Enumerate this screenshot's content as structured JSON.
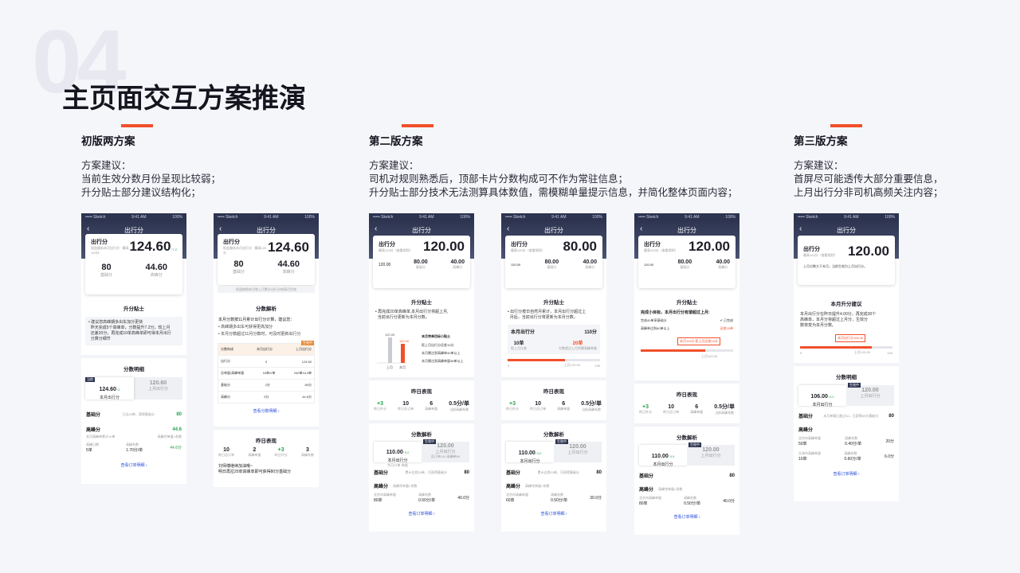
{
  "page": {
    "number": "04",
    "title": "主页面交互方案推演"
  },
  "sections": [
    {
      "heading": "初版两方案",
      "desc": "方案建议：\n当前生效分数月份呈现比较弱；\n升分贴士部分建议结构化；"
    },
    {
      "heading": "第二版方案",
      "desc": "方案建议：\n司机对规则熟悉后，顶部卡片分数构成可不作为常驻信息；\n升分贴士部分技术无法测算具体数值，需模糊单量提示信息，并简化整体页面内容；"
    },
    {
      "heading": "第三版方案",
      "desc": "方案建议：\n首屏尽可能透传大部分重要信息，\n上月出行分非司机高频关注内容；"
    }
  ],
  "phone": {
    "carrier": "••••• Sketch",
    "time": "9:41 AM",
    "battery": "100%",
    "back": "‹",
    "nav_title": "出行分",
    "score_label": "出行分",
    "link_detail": "查看订单明细 ›",
    "link_analysis": "查看分数明细 ›"
  },
  "p1": {
    "sub": "权益服务本月出行分 · 最高120分",
    "score": "124.60",
    "delta": "↑7.2",
    "base": "80",
    "base_l": "基础分",
    "peak": "44.60",
    "peak_l": "高峰分",
    "tips_t": "升分贴士",
    "tips": "• 建议您高峰期多出车加分更快\n  昨天完成5个高峰单，分数提升7.2分，较上月\n  还差20分，再完成10单高峰单即可得本月出行\n  分算分细节",
    "detail_t": "分数明细",
    "tag": "当前",
    "cur": "124.60",
    "cur_d": "+2",
    "cur_l": "本月出行分",
    "last": "120.60",
    "last_l": "上月出行分",
    "r1_l": "基础分",
    "r1_s": "已达20单，获得基础分",
    "r1_v": "80",
    "r2_l": "高峰分",
    "r2_v": "44.6",
    "r2_s": "本月高峰单累计10单",
    "r2_s2": "高峰完单量×系数",
    "r3_a": "高峰日期",
    "r3_a2": "5单",
    "r3_b": "高峰系数",
    "r3_b2": "1.70分/单",
    "r3_v": "44.6分"
  },
  "p2": {
    "sub": "权益服务本月出行分 · 最高120分",
    "score": "124.60",
    "base": "80",
    "base_l": "基础分",
    "peak": "44.60",
    "peak_l": "高峰分",
    "note": "权益按照本月和上月累计出行分较高月生效",
    "an_t": "分数解析",
    "an_1": "本月分数按11月累计出行分计算，建议您：",
    "an_2": "• 高峰期多出车可获得更高加分",
    "an_3": "• 本月分数超过11月分数时，可及时更新出行分",
    "th": [
      "分数构成",
      "本月出行分",
      "上月出行分"
    ],
    "tag": "生效中",
    "rows": [
      [
        "出行分",
        "3",
        "124.60"
      ],
      [
        "总单量/高峰单量",
        "16单/2单",
        "240单/114单"
      ],
      [
        "基础分",
        "2分",
        "80分"
      ],
      [
        "高峰分",
        "2分",
        "44.6分"
      ]
    ],
    "y_t": "昨日表现",
    "y": [
      [
        "10",
        "昨日总订单"
      ],
      [
        "2",
        "高峰单量"
      ],
      [
        "+3",
        "昨日升分"
      ],
      [
        "3",
        "高峰系数"
      ]
    ],
    "msg": "刘师傅继续加油哦~\n明日再拉20单高峰单即可获得80分基础分"
  },
  "v2a": {
    "sub": "最高120分（查看规则）",
    "score": "120.00",
    "last": "120.00",
    "base": "80.00",
    "base_l": "基础分",
    "peak": "40.00",
    "peak_l": "高峰分",
    "tips_t": "升分贴士",
    "tips": "• 再完成20单高峰单,本月出行分将超上月,\n  当前出行分更新为本月分数。",
    "leg": "本月完单目标小贴士",
    "l1": "距上月出行分还差10分",
    "l2": "本月需达到高峰单40单以上",
    "l3": "本月需达到高峰单量38单以上",
    "bv1": "120.00",
    "bv2": "110.00",
    "bx1": "上月",
    "bx2": "本月",
    "y_t": "昨日表现",
    "y": [
      [
        "+3",
        "昨日升分"
      ],
      [
        "10",
        "昨日总订单"
      ],
      [
        "6",
        "高峰单量"
      ],
      [
        "0.5分/单",
        "当前高峰系数"
      ]
    ],
    "an_t": "分数解析",
    "cur": "110.00",
    "cur_d": "↑3.0",
    "cur_l": "本月出行分",
    "cur_s": "作日21单·单量",
    "tag": "生效中",
    "last_l": "上月出行分",
    "last_s": "总订单140·高峰单80",
    "r1": "基础分",
    "r1_s": "累计达到20单，可获得基础分",
    "r1_v": "80",
    "r2": "高峰分",
    "r2_s": "高峰完单量×系数",
    "r3_a": "北京市高峰单量",
    "r3_a2": "80单",
    "r3_b": "高峰系数",
    "r3_b2": "0.50分/单",
    "r3_v": "40.0分"
  },
  "v2b": {
    "sub": "最高120分（查看规则）",
    "score": "80.00",
    "last": "120.00",
    "base": "80.00",
    "base_l": "基础分",
    "peak": "40.00",
    "peak_l": "高峰分",
    "tips_t": "升分贴士",
    "tips": "• 出行分按日自然月累计，本月出行分超过上\n  月后，当前出行分将更新为本月分数。",
    "box_l": "本月出行分",
    "box_v": "110分",
    "s1": "10单",
    "s1_l": "距上月分差",
    "s2": "20单",
    "s2_l": "分数超过上月所需高峰单量",
    "ax0": "0",
    "ax1": "上月120.00",
    "ax2": "130",
    "y_t": "昨日表现",
    "y": [
      [
        "+3",
        "昨日升分"
      ],
      [
        "10",
        "昨日总订单"
      ],
      [
        "6",
        "高峰单量"
      ],
      [
        "0.5分/单",
        "当前高峰系数"
      ]
    ],
    "an_t": "分数解析",
    "cur": "110.00",
    "cur_d": "↑3.0",
    "cur_l": "本月出行分",
    "tag": "生效中",
    "last_l": "上月出行分",
    "r1": "基础分",
    "r1_s": "累计达到20单，可获得基础分",
    "r1_v": "80",
    "r2": "高峰分",
    "r2_s": "高峰完单量×系数",
    "r3_a": "北京市高峰单量",
    "r3_a2": "60单",
    "r3_b": "高峰系数",
    "r3_b2": "0.50分/单",
    "r3_v": "30.0分"
  },
  "v2c": {
    "sub": "最高120分（查看规则）",
    "score": "120.00",
    "last": "120.00",
    "base": "80.00",
    "base_l": "基础分",
    "peak": "40.00",
    "peak_l": "高峰分",
    "tips_t": "升分贴士",
    "h": "完成小目标，本月出行分有望超过上月:",
    "c1": "完成40单享基础分",
    "c1s": "✔ 已完成",
    "c2": "高峰单达到60单以上",
    "c2s": "还差20单",
    "bubble": "本月110分 距上月还差10分",
    "ax": "上月120.00",
    "y_t": "昨日表现",
    "y": [
      [
        "+3",
        "昨日升分"
      ],
      [
        "10",
        "昨日总订单"
      ],
      [
        "6",
        "高峰单量"
      ],
      [
        "0.5分/单",
        "当前高峰系数"
      ]
    ],
    "an_t": "分数解析",
    "cur": "110.00",
    "cur_d": "↑3.0",
    "cur_l": "本月出行分",
    "tag": "生效中",
    "last_l": "上月出行分",
    "r1": "基础分",
    "r1_v": "80",
    "r2": "高峰分",
    "r2_s": "高峰完单量×系数",
    "r3_a": "北京市高峰单量",
    "r3_a2": "80单",
    "r3_b": "高峰系数",
    "r3_b2": "0.50分/单",
    "r3_v": "40.0分"
  },
  "v3": {
    "sub": "最高120分（查看规则）",
    "score": "120.00",
    "note": "上月分数大于本月，当前生效为上月出行分。",
    "adv_t": "本月升分建议",
    "adv": "本月出行分在昨日提升4.00分，再完成30个\n高峰单，本月分将超过上月分，生效分\n数将变为本月分数。",
    "bubble": "本月出行分106.00",
    "ax0": "0",
    "ax1": "上月120.00",
    "ax2": "130",
    "d_t": "分数明细",
    "cur": "106.00",
    "cur_d": "↑4.0",
    "cur_l": "本月出行分",
    "tag": "生效中",
    "last": "120.00",
    "last_l": "上月出行分",
    "r1": "基础分",
    "r1_s": "本月单量已超过10，已获得80分基础分",
    "r1_v": "80",
    "r2": "高峰分",
    "c1a": "北京市高峰单量",
    "c1a2": "50单",
    "c1b": "高峰系数",
    "c1b2": "0.40分/单",
    "c1v": "20分",
    "c2a": "天津市高峰单量",
    "c2a2": "10单",
    "c2b": "高峰系数",
    "c2b2": "0.60分/单",
    "c2v": "6.0分"
  }
}
